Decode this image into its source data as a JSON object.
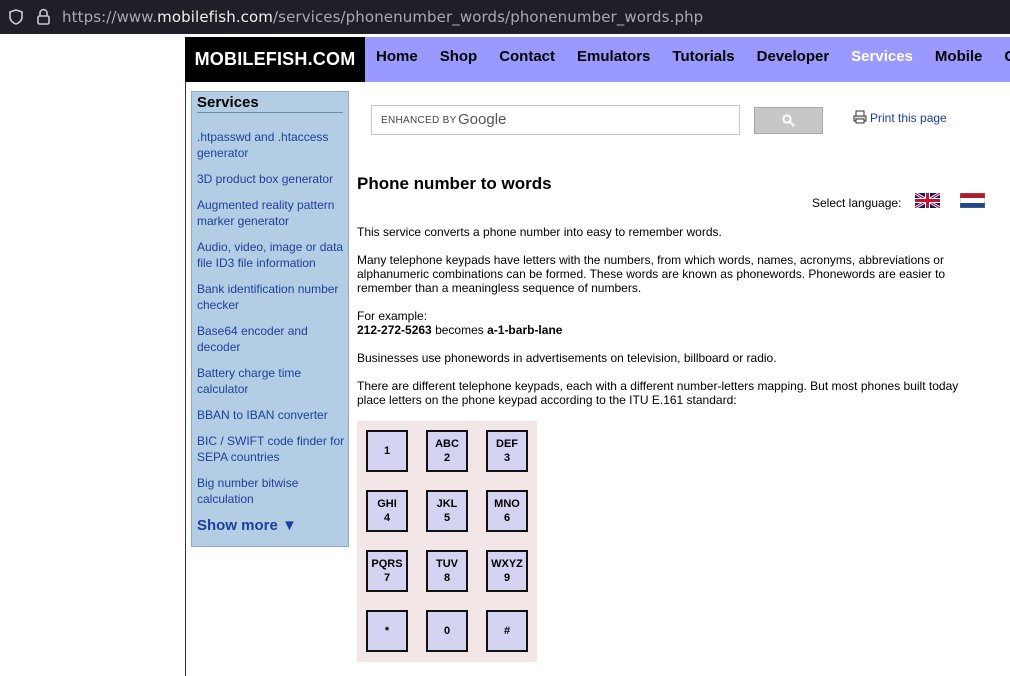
{
  "browser": {
    "url_prefix": "https://www.",
    "url_domain": "mobilefish.com",
    "url_path": "/services/phonenumber_words/phonenumber_words.php"
  },
  "header": {
    "logo": "MOBILEFISH.COM",
    "nav": [
      "Home",
      "Shop",
      "Contact",
      "Emulators",
      "Tutorials",
      "Developer",
      "Services",
      "Mobile",
      "Game"
    ],
    "active_nav": "Services"
  },
  "sidebar": {
    "title": "Services",
    "items": [
      ".htpasswd and .htaccess generator",
      "3D product box generator",
      "Augmented reality pattern marker generator",
      "Audio, video, image or data file ID3 file information",
      "Bank identification number checker",
      "Base64 encoder and decoder",
      "Battery charge time calculator",
      "BBAN to IBAN converter",
      "BIC / SWIFT code finder for SEPA countries",
      "Big number bitwise calculation"
    ],
    "show_more": "Show more ▼"
  },
  "search": {
    "enhanced_by": "ENHANCED BY",
    "google": "Google"
  },
  "print_label": "Print this page",
  "page": {
    "title": "Phone number to words",
    "select_language": "Select language:",
    "intro": "This service converts a phone number into easy to remember words.",
    "para2": "Many telephone keypads have letters with the numbers, from which words, names, acronyms, abbreviations or alphanumeric combinations can be formed. These words are known as phonewords. Phonewords are easier to remember than a meaningless sequence of numbers.",
    "example_label": "For example:",
    "example_number": "212-272-5263",
    "example_becomes": " becomes ",
    "example_word": "a-1-barb-lane",
    "para4": "Businesses use phonewords in advertisements on television, billboard or radio.",
    "para5": "There are different telephone keypads, each with a different number-letters mapping. But most phones built today place letters on the phone keypad according to the ITU E.161 standard:"
  },
  "keypad": [
    {
      "letters": "",
      "digit": "1"
    },
    {
      "letters": "ABC",
      "digit": "2"
    },
    {
      "letters": "DEF",
      "digit": "3"
    },
    {
      "letters": "GHI",
      "digit": "4"
    },
    {
      "letters": "JKL",
      "digit": "5"
    },
    {
      "letters": "MNO",
      "digit": "6"
    },
    {
      "letters": "PQRS",
      "digit": "7"
    },
    {
      "letters": "TUV",
      "digit": "8"
    },
    {
      "letters": "WXYZ",
      "digit": "9"
    },
    {
      "letters": "",
      "digit": "*"
    },
    {
      "letters": "",
      "digit": "0"
    },
    {
      "letters": "",
      "digit": "#"
    }
  ]
}
